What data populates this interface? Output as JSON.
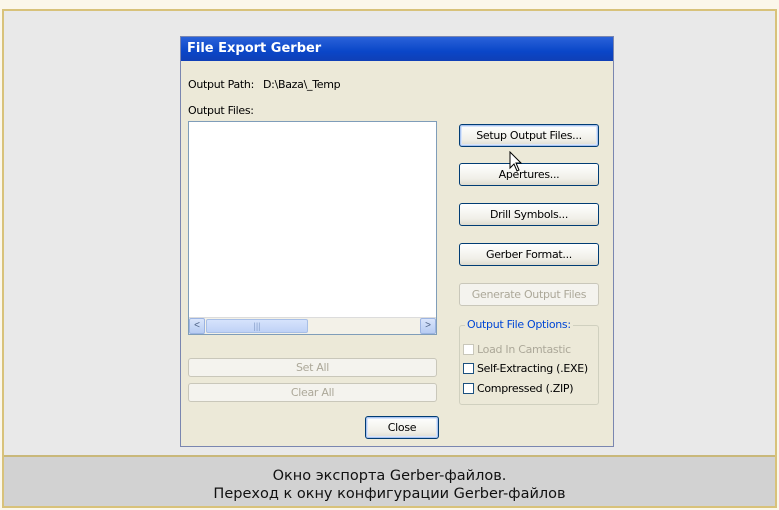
{
  "dialog": {
    "title": "File Export Gerber",
    "output_path_label": "Output Path:",
    "output_path_value": "D:\\Baza\\_Temp",
    "output_files_label": "Output Files:",
    "output_files": [],
    "scrollbar": {
      "left_arrow": "<",
      "right_arrow": ">",
      "thumb_grip": "|||"
    }
  },
  "buttons": {
    "setup_output_files": "Setup Output Files...",
    "apertures": "Apertures...",
    "drill_symbols": "Drill Symbols...",
    "gerber_format": "Gerber Format...",
    "generate_output_files": "Generate Output Files",
    "set_all": "Set All",
    "clear_all": "Clear All",
    "close": "Close"
  },
  "options": {
    "title": "Output File Options:",
    "load_in_camtastic": {
      "label": "Load In Camtastic",
      "checked": false,
      "enabled": false
    },
    "self_extracting": {
      "label": "Self-Extracting (.EXE)",
      "checked": false,
      "enabled": true
    },
    "compressed": {
      "label": "Compressed (.ZIP)",
      "checked": false,
      "enabled": true
    }
  },
  "caption": {
    "line1": "Окно экспорта Gerber-файлов.",
    "line2": "Переход к окну конфигурации Gerber-файлов"
  },
  "colors": {
    "titlebar": "#0a46c8",
    "dialog_bg": "#ece9d8",
    "group_title": "#0046d5",
    "frame_border": "#d8c27a"
  }
}
